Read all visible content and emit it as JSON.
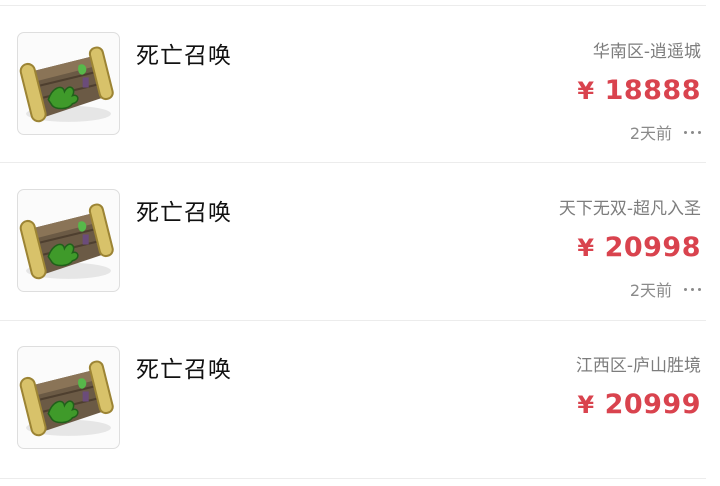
{
  "listings": [
    {
      "title": "死亡召唤",
      "server": "华南区-逍遥城",
      "currency": "¥",
      "price": "18888",
      "time": "2天前",
      "show_meta": true
    },
    {
      "title": "死亡召唤",
      "server": "天下无双-超凡入圣",
      "currency": "¥",
      "price": "20998",
      "time": "2天前",
      "show_meta": true
    },
    {
      "title": "死亡召唤",
      "server": "江西区-庐山胜境",
      "currency": "¥",
      "price": "20999",
      "time": "",
      "show_meta": false
    }
  ],
  "icons": {
    "thumbnail": "scroll-item-icon",
    "more": "more-options-icon"
  },
  "colors": {
    "price": "#d9434e",
    "secondary_text": "#7d7d7d",
    "divider": "#ececec"
  }
}
